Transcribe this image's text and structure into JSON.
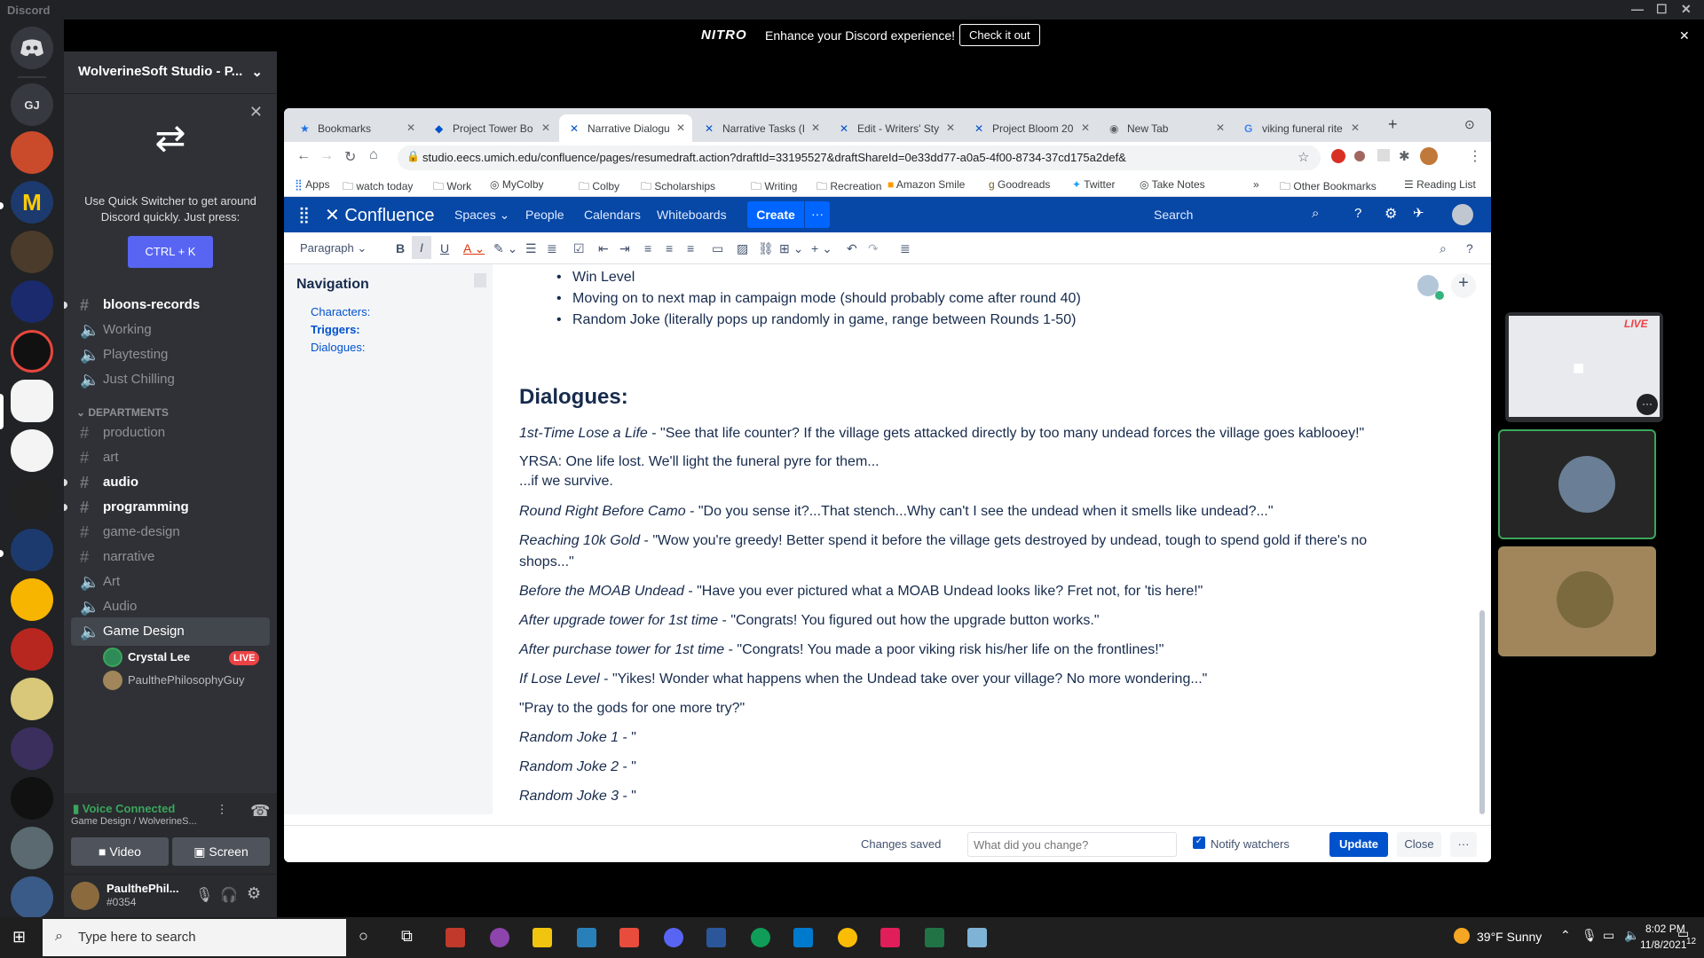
{
  "app": {
    "title": "Discord"
  },
  "nitro": {
    "brand": "NITRO",
    "message": "Enhance your Discord experience!",
    "cta": "Check it out"
  },
  "rail": {
    "gj_label": "GJ"
  },
  "guild": {
    "name": "WolverineSoft Studio - P..."
  },
  "quickswitcher": {
    "message": "Use Quick Switcher to get around Discord quickly. Just press:",
    "shortcut": "CTRL + K"
  },
  "channels": [
    {
      "name": "bloons-records",
      "type": "text",
      "unread": true
    },
    {
      "name": "Working",
      "type": "voice"
    },
    {
      "name": "Playtesting",
      "type": "voice"
    },
    {
      "name": "Just Chilling",
      "type": "voice"
    }
  ],
  "category": "DEPARTMENTS",
  "dept_channels": [
    {
      "name": "production",
      "type": "text"
    },
    {
      "name": "art",
      "type": "text"
    },
    {
      "name": "audio",
      "type": "text",
      "unread": true
    },
    {
      "name": "programming",
      "type": "text",
      "unread": true
    },
    {
      "name": "game-design",
      "type": "text"
    },
    {
      "name": "narrative",
      "type": "text"
    },
    {
      "name": "Art",
      "type": "voice"
    },
    {
      "name": "Audio",
      "type": "voice"
    },
    {
      "name": "Game Design",
      "type": "voice",
      "selected": true
    }
  ],
  "voice_users": [
    {
      "name": "Crystal Lee",
      "live": "LIVE"
    },
    {
      "name": "PaulthePhilosophyGuy"
    }
  ],
  "voice": {
    "status": "Voice Connected",
    "location": "Game Design / WolverineS...",
    "video": "Video",
    "screen": "Screen"
  },
  "user": {
    "name": "PaulthePhil...",
    "tag": "#0354"
  },
  "browser": {
    "tabs": [
      {
        "title": "Bookmarks"
      },
      {
        "title": "Project Tower Bo"
      },
      {
        "title": "Narrative Dialogu",
        "active": true
      },
      {
        "title": "Narrative Tasks (I"
      },
      {
        "title": "Edit - Writers' Sty"
      },
      {
        "title": "Project Bloom 20"
      },
      {
        "title": "New Tab"
      },
      {
        "title": "viking funeral rite"
      }
    ],
    "url": "studio.eecs.umich.edu/confluence/pages/resumedraft.action?draftId=33195527&draftShareId=0e33dd77-a0a5-4f00-8734-37cd175a2def&",
    "bookmarks": [
      "Apps",
      "watch today",
      "Work",
      "MyColby",
      "Colby",
      "Scholarships",
      "Writing",
      "Recreation",
      "Amazon Smile",
      "Goodreads",
      "Twitter",
      "Take Notes"
    ],
    "bookmarks_right": [
      "Other Bookmarks",
      "Reading List"
    ]
  },
  "confluence": {
    "brand": "Confluence",
    "nav": [
      "Spaces",
      "People",
      "Calendars",
      "Whiteboards"
    ],
    "create": "Create",
    "search": "Search",
    "paragraph": "Paragraph",
    "navigation": {
      "title": "Navigation",
      "links": [
        "Characters:",
        "Triggers:",
        "Dialogues:"
      ]
    },
    "bullets": [
      "Win Level",
      "Moving on to next map in campaign mode (should probably come after round 40)",
      "Random Joke (literally pops up randomly in game, range between Rounds 1-50)"
    ],
    "heading": "Dialogues:",
    "lines": [
      {
        "trigger": "1st-Time Lose a Life",
        "text": " - \"See that life counter? If the village gets attacked directly by too many undead forces the village goes kablooey!\""
      },
      {
        "trigger": "",
        "text": "YRSA: One life lost. We'll light the funeral pyre for them..."
      },
      {
        "trigger": "",
        "text": "...if we survive."
      },
      {
        "trigger": "Round Right Before Camo",
        "text": " - \"Do you sense it?...That stench...Why can't I see the undead when it smells like undead?...\""
      },
      {
        "trigger": "Reaching 10k Gold",
        "text": " - \"Wow you're greedy! Better spend it before the village gets destroyed by undead, tough to spend gold if there's no"
      },
      {
        "trigger": "",
        "text": "shops...\""
      },
      {
        "trigger": "Before the MOAB Undead",
        "text": " - \"Have you ever pictured what a MOAB Undead looks like? Fret not, for 'tis here!\""
      },
      {
        "trigger": "After upgrade tower for 1st time",
        "text": " - \"Congrats! You figured out how the upgrade button works.\""
      },
      {
        "trigger": "After purchase tower for 1st time",
        "text": " - \"Congrats! You made a poor viking risk his/her life on the frontlines!\""
      },
      {
        "trigger": "If Lose Level",
        "text": " - \"Yikes! Wonder what happens when the Undead take over your village? No more wondering...\""
      },
      {
        "trigger": "",
        "text": "\"Pray to the gods for one more try?\""
      },
      {
        "trigger": "Random Joke 1",
        "text": " - \""
      },
      {
        "trigger": "Random Joke 2",
        "text": " - \""
      },
      {
        "trigger": "Random Joke 3",
        "text": " - \""
      }
    ],
    "footer": {
      "saved": "Changes saved",
      "placeholder": "What did you change?",
      "notify": "Notify watchers",
      "update": "Update",
      "close": "Close",
      "more": "···"
    }
  },
  "stream": {
    "live": "LIVE"
  },
  "taskbar": {
    "search": "Type here to search",
    "weather": "39°F  Sunny",
    "time": "8:02 PM",
    "date": "11/8/2021",
    "notif": "12"
  }
}
